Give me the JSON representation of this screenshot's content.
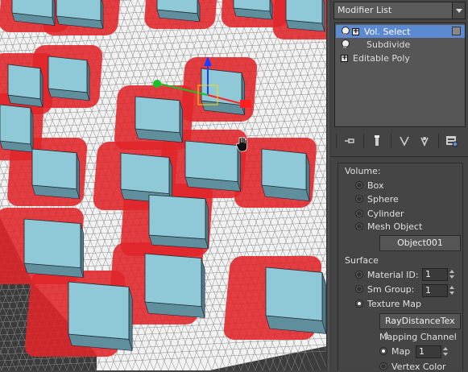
{
  "modifier_list": {
    "label": "Modifier List"
  },
  "stack": [
    {
      "label": "Vol. Select",
      "selected": true,
      "has_bulb": true,
      "has_plus": true
    },
    {
      "label": "Subdivide",
      "selected": false,
      "has_bulb": true,
      "has_plus": false
    },
    {
      "label": "Editable Poly",
      "selected": false,
      "has_bulb": false,
      "has_plus": true
    }
  ],
  "toolbar_icons": [
    "pin-stack-icon",
    "show-end-result-icon",
    "make-unique-icon",
    "remove-modifier-icon",
    "configure-modifier-sets-icon"
  ],
  "volume": {
    "title": "Volume:",
    "options": [
      {
        "label": "Box",
        "checked": false
      },
      {
        "label": "Sphere",
        "checked": false
      },
      {
        "label": "Cylinder",
        "checked": false
      },
      {
        "label": "Mesh Object",
        "checked": false
      }
    ],
    "object_button": "Object001"
  },
  "surface": {
    "title": "Surface",
    "material_id": {
      "label": "Material ID:",
      "value": "1",
      "checked": false
    },
    "sm_group": {
      "label": "Sm Group:",
      "value": "1",
      "checked": false
    },
    "texture_map": {
      "label": "Texture Map",
      "checked": true
    },
    "texture_button": "RayDistanceTex )"
  },
  "mapping": {
    "title": "Mapping Channel",
    "map": {
      "label": "Map",
      "value": "1",
      "checked": true
    },
    "vertex_color": {
      "label": "Vertex Color",
      "checked": false
    }
  },
  "colors": {
    "selection_red": "#e0252a",
    "box_top": "#8fc8d6",
    "box_side": "#5f8f9c",
    "wire": "#ffffff",
    "selected_row": "#5c8ad2"
  }
}
